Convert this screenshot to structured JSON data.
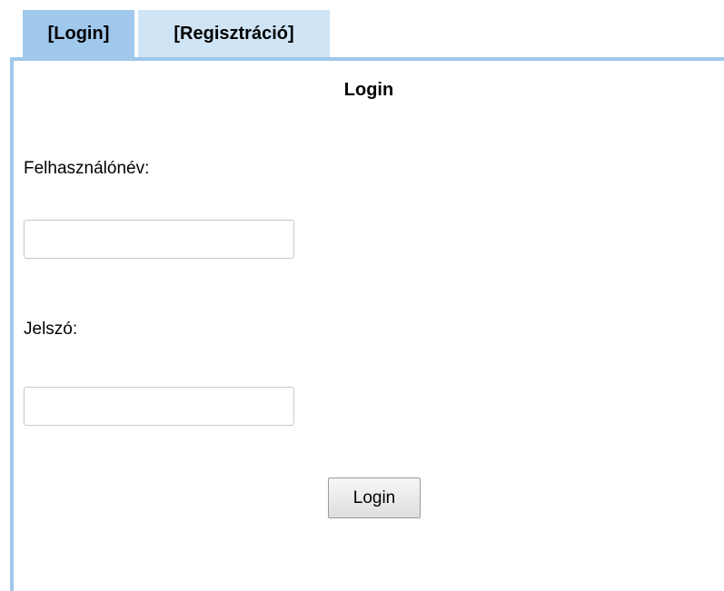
{
  "tabs": [
    {
      "label": "[Login]",
      "active": true
    },
    {
      "label": "[Regisztráció]",
      "active": false
    }
  ],
  "form": {
    "title": "Login",
    "username_label": "Felhasználónév:",
    "username_value": "",
    "password_label": "Jelszó:",
    "password_value": "",
    "submit_label": "Login"
  },
  "colors": {
    "active_tab": "#9fc8ec",
    "inactive_tab": "#cfe4f5",
    "panel_border": "#9fc8ec"
  }
}
